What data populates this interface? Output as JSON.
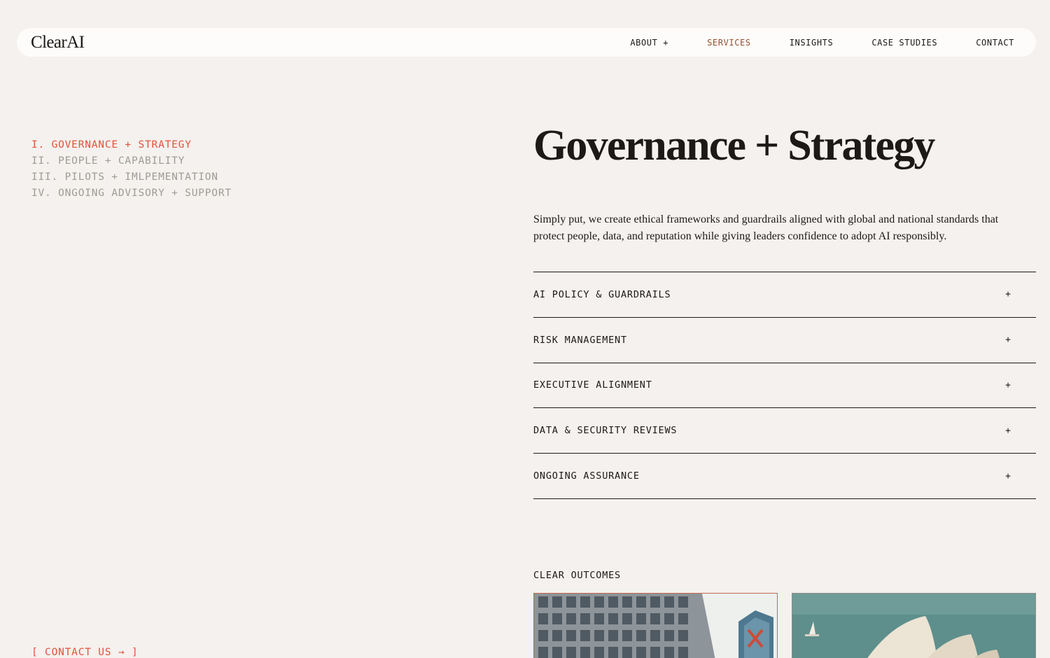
{
  "brand": {
    "logo": "ClearAI"
  },
  "nav": {
    "items": [
      {
        "label": "ABOUT +",
        "active": false
      },
      {
        "label": "SERVICES",
        "active": true
      },
      {
        "label": "INSIGHTS",
        "active": false
      },
      {
        "label": "CASE STUDIES",
        "active": false
      },
      {
        "label": "CONTACT",
        "active": false
      }
    ]
  },
  "sidebar": {
    "items": [
      {
        "label": "I. GOVERNANCE + STRATEGY",
        "active": true
      },
      {
        "label": "II. PEOPLE + CAPABILITY",
        "active": false
      },
      {
        "label": "III. PILOTS + IMLPEMENTATION",
        "active": false
      },
      {
        "label": "IV. ONGOING ADVISORY + SUPPORT",
        "active": false
      }
    ],
    "contact_cta": "[ CONTACT US → ]"
  },
  "main": {
    "title": "Governance + Strategy",
    "intro": "Simply put, we create ethical frameworks and guardrails aligned with global and national standards that protect people, data, and reputation while giving leaders confidence to adopt AI responsibly.",
    "accordion": [
      {
        "label": "AI POLICY & GUARDRAILS",
        "toggle": "+"
      },
      {
        "label": "RISK MANAGEMENT",
        "toggle": "+"
      },
      {
        "label": "EXECUTIVE ALIGNMENT",
        "toggle": "+"
      },
      {
        "label": "DATA & SECURITY REVIEWS",
        "toggle": "+"
      },
      {
        "label": "ONGOING ASSURANCE",
        "toggle": "+"
      }
    ],
    "outcomes_label": "CLEAR OUTCOMES"
  },
  "colors": {
    "background": "#f4f1ee",
    "accent": "#e0533a",
    "active_nav": "#9a4d2e",
    "text": "#1c1916",
    "muted": "#9f9a95"
  },
  "icons": {
    "accordion_toggle": "plus-icon",
    "cta_arrow": "arrow-right-icon"
  }
}
